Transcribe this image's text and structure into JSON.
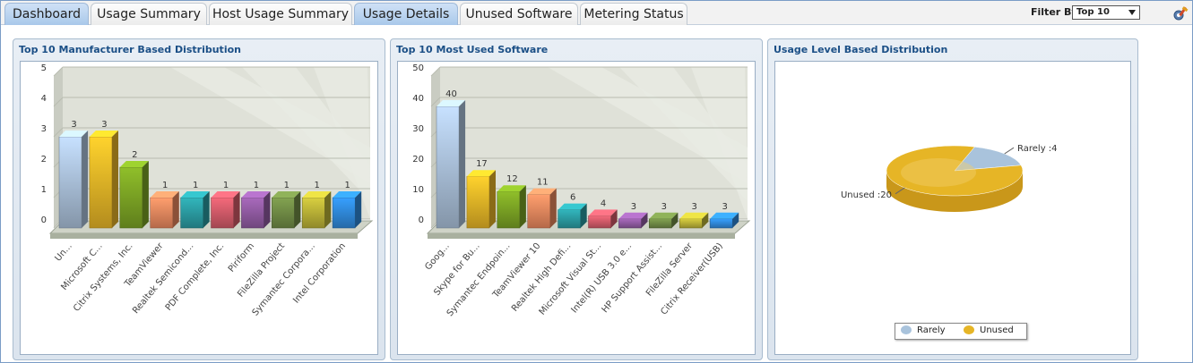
{
  "tabs": [
    {
      "label": "Dashboard",
      "style": "blue"
    },
    {
      "label": "Usage Summary",
      "style": "white"
    },
    {
      "label": "Host Usage Summary",
      "style": "white"
    },
    {
      "label": "Usage Details",
      "style": "blue"
    },
    {
      "label": "Unused Software",
      "style": "white"
    },
    {
      "label": "Metering Status",
      "style": "white"
    }
  ],
  "filter": {
    "label": "Filter By",
    "value": "Top 10"
  },
  "icons": {
    "settings": "settings-tools-icon"
  },
  "colors": {
    "panel_title": "#1b4f86",
    "bar_palette": [
      "#a9bfd8",
      "#e6b326",
      "#7aa224",
      "#e8875d",
      "#2a9aa0",
      "#d05a68",
      "#8f5aa0",
      "#6f8a45",
      "#b8b036",
      "#2f88d8"
    ]
  },
  "panels": [
    {
      "title": "Top 10 Manufacturer Based Distribution"
    },
    {
      "title": "Top 10 Most Used Software"
    },
    {
      "title": "Usage Level Based Distribution"
    }
  ],
  "chart_data": [
    {
      "type": "bar",
      "title": "Top 10 Manufacturer Based Distribution",
      "categories": [
        "Un...",
        "Microsoft C...",
        "Citrix Systems, Inc.",
        "TeamViewer",
        "Realtek Semicond...",
        "PDF Complete, Inc.",
        "Piriform",
        "FileZilla Project",
        "Symantec Corpora...",
        "Intel Corporation"
      ],
      "values": [
        3,
        3,
        2,
        1,
        1,
        1,
        1,
        1,
        1,
        1
      ],
      "ylim": [
        0,
        5
      ],
      "yticks": [
        "0",
        "1",
        "2",
        "3",
        "4",
        "5"
      ],
      "grid": true
    },
    {
      "type": "bar",
      "title": "Top 10 Most Used Software",
      "categories": [
        "Goog...",
        "Skype for Bu...",
        "Symantec Endpoin...",
        "TeamViewer 10",
        "Realtek High Defi...",
        "Microsoft Visual St...",
        "Intel(R) USB 3.0 e...",
        "HP Support Assist...",
        "FileZilla Server",
        "Citrix Receiver(USB)"
      ],
      "values": [
        40,
        17,
        12,
        11,
        6,
        4,
        3,
        3,
        3,
        3
      ],
      "ylim": [
        0,
        50
      ],
      "yticks": [
        "0",
        "10",
        "20",
        "30",
        "40",
        "50"
      ],
      "grid": true
    },
    {
      "type": "pie",
      "title": "Usage Level Based Distribution",
      "slices": [
        {
          "name": "Rarely",
          "label": "Rarely :4",
          "value": 4,
          "color": "#a9c3dc"
        },
        {
          "name": "Unused",
          "label": "Unused :20",
          "value": 20,
          "color": "#e6b526"
        }
      ],
      "legend": [
        "Rarely",
        "Unused"
      ],
      "legend_position": "bottom"
    }
  ]
}
